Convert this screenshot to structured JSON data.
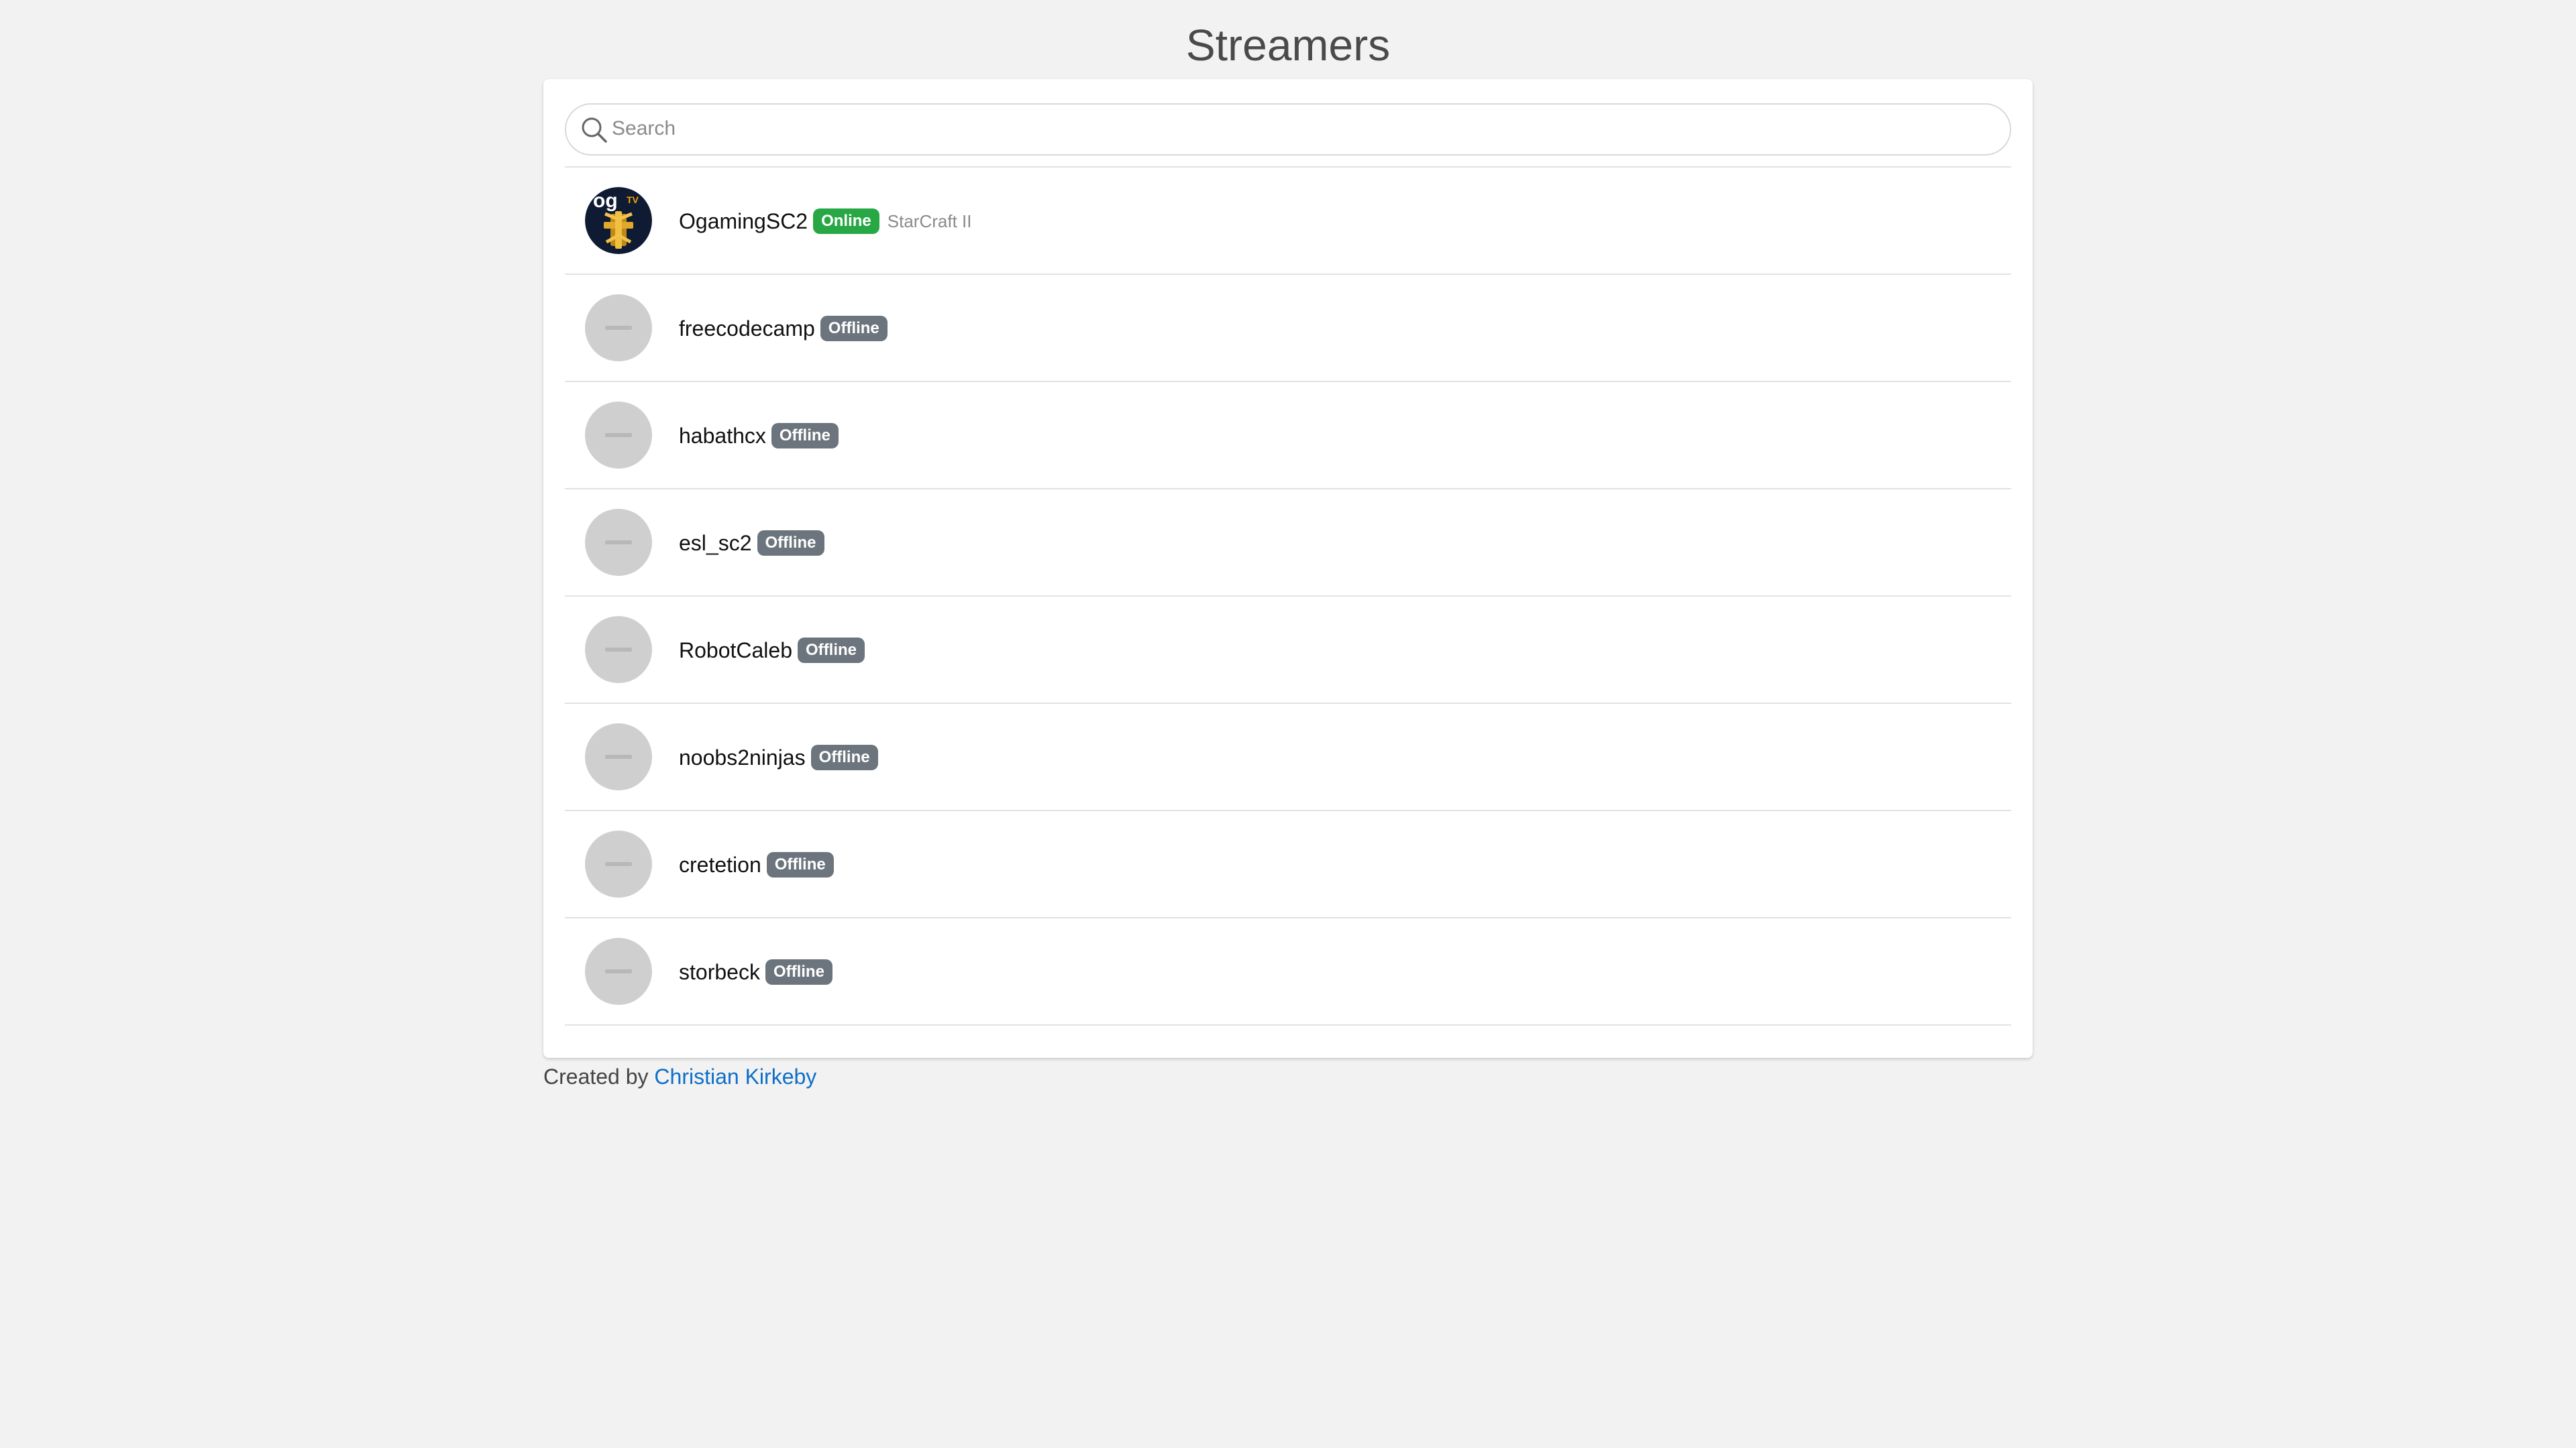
{
  "header": {
    "title": "Streamers"
  },
  "search": {
    "placeholder": "Search",
    "value": "",
    "icon": "search-icon"
  },
  "streamers": [
    {
      "name": "OgamingSC2",
      "status": "Online",
      "game": "StarCraft II",
      "avatar": "ogaming-logo"
    },
    {
      "name": "freecodecamp",
      "status": "Offline",
      "avatar": "placeholder"
    },
    {
      "name": "habathcx",
      "status": "Offline",
      "avatar": "placeholder"
    },
    {
      "name": "esl_sc2",
      "status": "Offline",
      "avatar": "placeholder"
    },
    {
      "name": "RobotCaleb",
      "status": "Offline",
      "avatar": "placeholder"
    },
    {
      "name": "noobs2ninjas",
      "status": "Offline",
      "avatar": "placeholder"
    },
    {
      "name": "cretetion",
      "status": "Offline",
      "avatar": "placeholder"
    },
    {
      "name": "storbeck",
      "status": "Offline",
      "avatar": "placeholder"
    }
  ],
  "avatar_logo": {
    "top_text": "og",
    "sub_text": "TV"
  },
  "footer": {
    "prefix": "Created by",
    "author": "Christian Kirkeby"
  },
  "colors": {
    "online": "#28a745",
    "offline": "#6c757d",
    "link": "#0d6ec9",
    "background": "#f2f2f2"
  }
}
